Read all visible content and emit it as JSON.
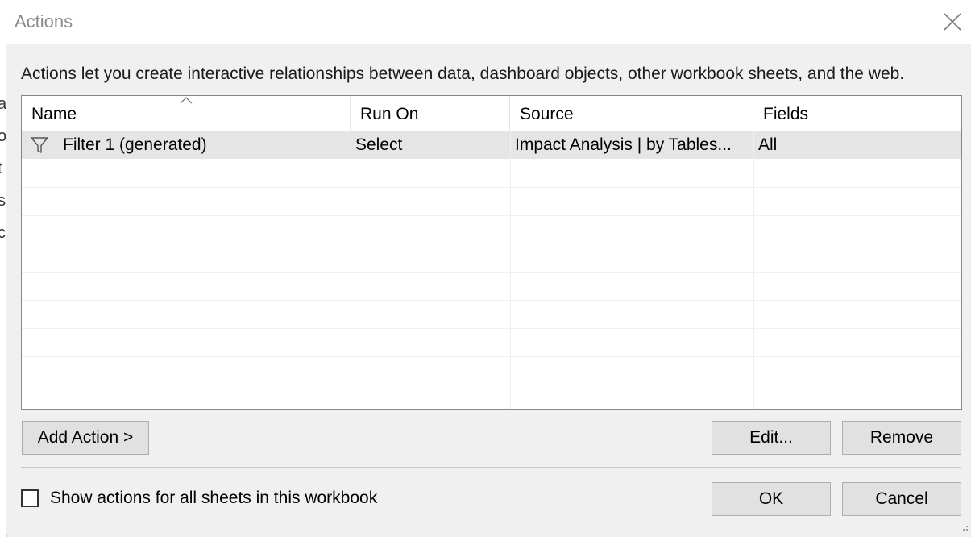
{
  "window": {
    "title": "Actions",
    "close_icon": "close-icon"
  },
  "description": "Actions let you create interactive relationships between data, dashboard objects, other workbook sheets, and the web.",
  "table": {
    "columns": [
      "Name",
      "Run On",
      "Source",
      "Fields"
    ],
    "sort_column": "Name",
    "rows": [
      {
        "icon": "filter-icon",
        "name": "Filter 1 (generated)",
        "run_on": "Select",
        "source": "Impact Analysis | by Tables...",
        "fields": "All",
        "selected": true
      }
    ]
  },
  "buttons": {
    "add_action": "Add Action >",
    "edit": "Edit...",
    "remove": "Remove",
    "ok": "OK",
    "cancel": "Cancel"
  },
  "checkbox": {
    "label": "Show actions for all sheets in this workbook",
    "checked": false
  },
  "background_letters": [
    "a",
    "o",
    "t",
    "s",
    "c"
  ]
}
